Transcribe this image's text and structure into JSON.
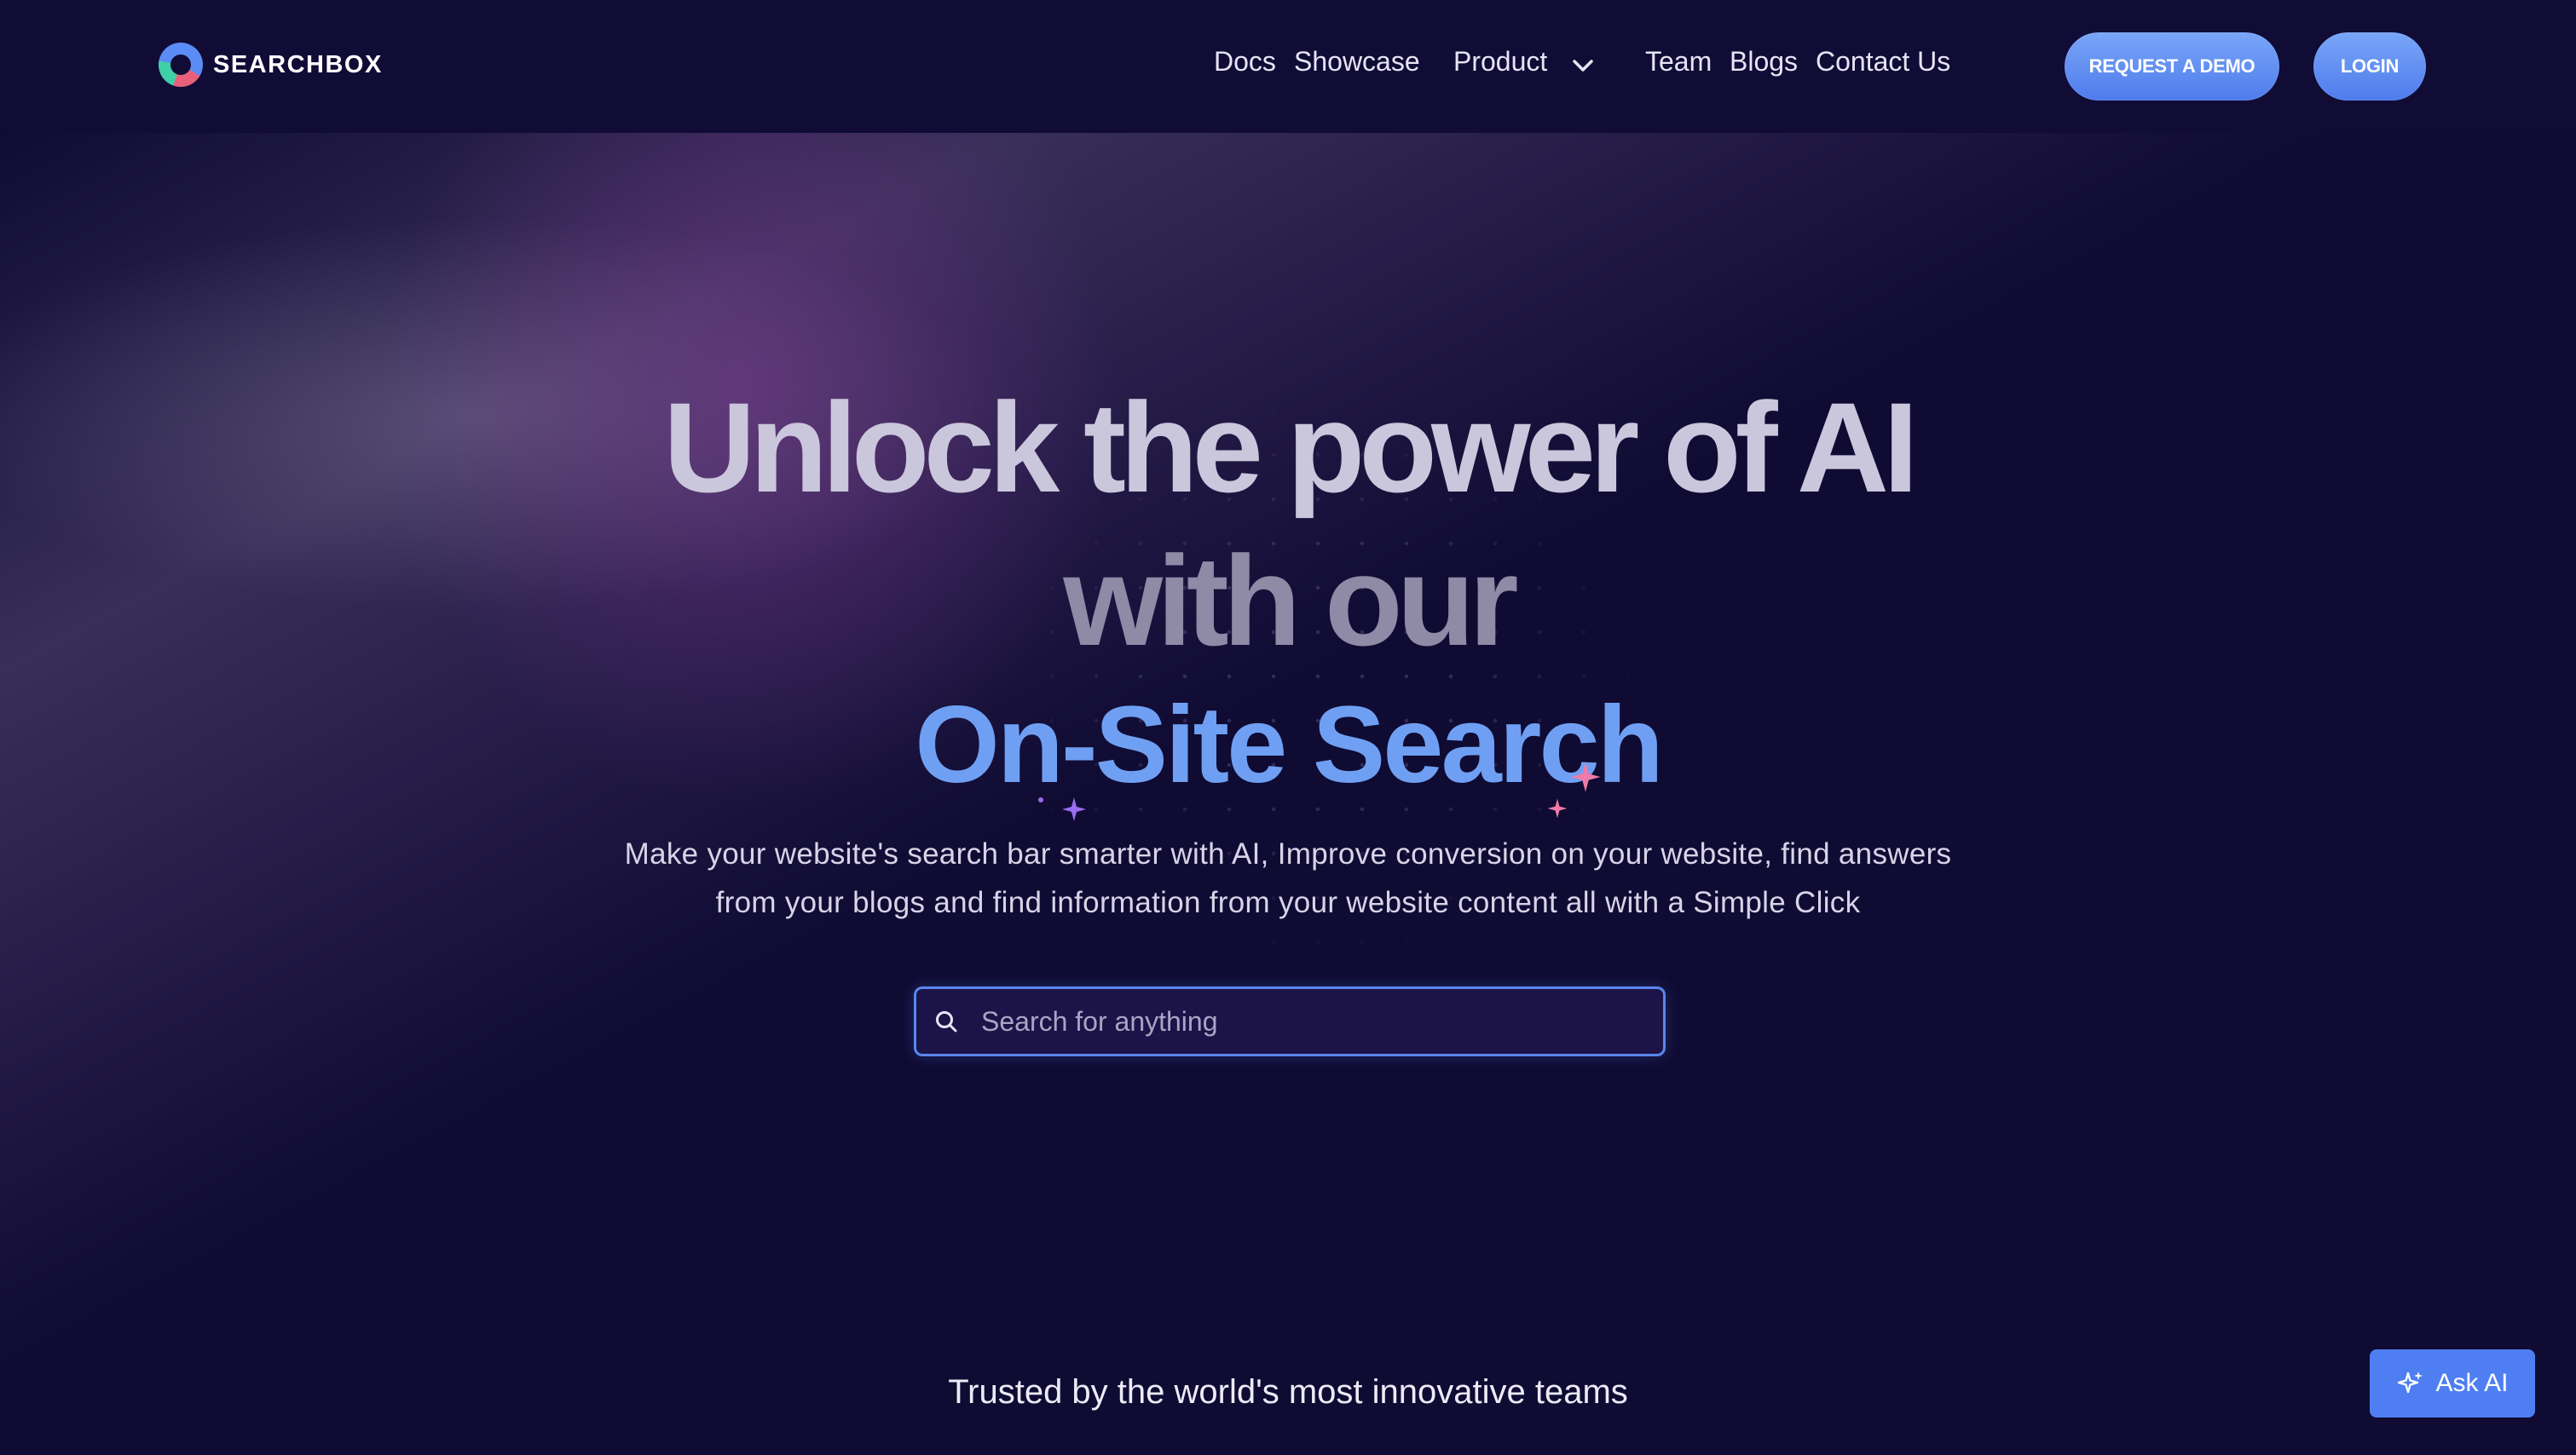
{
  "brand": {
    "name": "SEARCHBOX",
    "logo_icon": "searchbox-logo-icon"
  },
  "nav": {
    "items": [
      {
        "label": "Docs"
      },
      {
        "label": "Showcase"
      },
      {
        "label": "Product",
        "icon": "chevron-down-icon"
      },
      {
        "label": "Team"
      },
      {
        "label": "Blogs"
      },
      {
        "label": "Contact Us"
      }
    ],
    "request_demo_label": "REQUEST A DEMO",
    "login_label": "LOGIN"
  },
  "hero": {
    "line1": "Unlock the power of AI",
    "line2": "with our",
    "line3": "On-Site Search",
    "subtitle_line1": "Make your website's search bar smarter with AI, Improve conversion on your website, find answers",
    "subtitle_line2": "from your blogs and find information from your website content all with a Simple Click"
  },
  "search": {
    "placeholder": "Search for anything",
    "value": "",
    "icon": "search-icon"
  },
  "trusted": {
    "text": "Trusted by the world's most innovative teams"
  },
  "ask_ai": {
    "label": "Ask AI",
    "icon": "sparkle-icon"
  },
  "colors": {
    "background": "#0f0b33",
    "accent": "#4e7ef2",
    "headline_highlight": "#6f9ff2",
    "sparkle_pink": "#f07aa8",
    "sparkle_purple": "#9a6cf0"
  }
}
